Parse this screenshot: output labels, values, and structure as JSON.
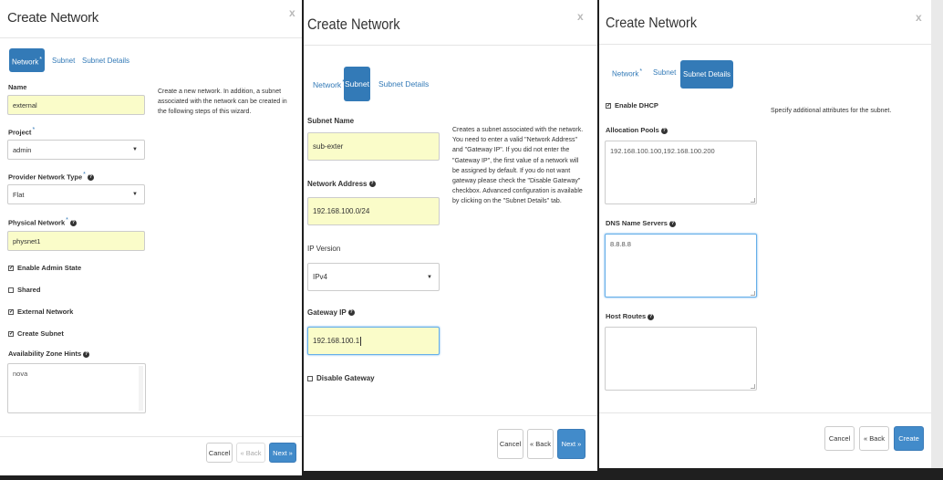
{
  "panel1": {
    "title": "Create Network",
    "close_glyph": "x",
    "tabs": [
      {
        "label": "Network",
        "required": "*",
        "active": true
      },
      {
        "label": "Subnet",
        "active": false
      },
      {
        "label": "Subnet Details",
        "active": false
      }
    ],
    "name": {
      "label": "Name",
      "value": "external"
    },
    "project": {
      "label": "Project",
      "required": "*",
      "value": "admin"
    },
    "provider_type": {
      "label": "Provider Network Type",
      "required": "*",
      "value": "Flat"
    },
    "physical_network": {
      "label": "Physical Network",
      "required": "*",
      "value": "physnet1"
    },
    "checkboxes": [
      {
        "label": "Enable Admin State",
        "checked": true
      },
      {
        "label": "Shared",
        "checked": false
      },
      {
        "label": "External Network",
        "checked": true
      },
      {
        "label": "Create Subnet",
        "checked": true
      }
    ],
    "az_hints": {
      "label": "Availability Zone Hints",
      "options": [
        "nova"
      ]
    },
    "description": "Create a new network. In addition, a subnet associated with the network can be created in the following steps of this wizard.",
    "buttons": {
      "cancel": "Cancel",
      "back": "« Back",
      "next": "Next »"
    }
  },
  "panel2": {
    "title": "Create Network",
    "close_glyph": "x",
    "tabs": [
      {
        "label": "Network",
        "required": "*",
        "active": false
      },
      {
        "label": "Subnet",
        "active": true
      },
      {
        "label": "Subnet Details",
        "active": false
      }
    ],
    "subnet_name": {
      "label": "Subnet Name",
      "value": "sub-exter"
    },
    "network_address": {
      "label": "Network Address",
      "value": "192.168.100.0/24"
    },
    "ip_version": {
      "label": "IP Version",
      "value": "IPv4"
    },
    "gateway_ip": {
      "label": "Gateway IP",
      "value": "192.168.100.1"
    },
    "disable_gateway": {
      "label": "Disable Gateway",
      "checked": false
    },
    "description": "Creates a subnet associated with the network. You need to enter a valid \"Network Address\" and \"Gateway IP\". If you did not enter the \"Gateway IP\", the first value of a network will be assigned by default. If you do not want gateway please check the \"Disable Gateway\" checkbox. Advanced configuration is available by clicking on the \"Subnet Details\" tab.",
    "buttons": {
      "cancel": "Cancel",
      "back": "« Back",
      "next": "Next »"
    }
  },
  "panel3": {
    "title": "Create Network",
    "close_glyph": "x",
    "tabs": [
      {
        "label": "Network",
        "required": "*",
        "active": false
      },
      {
        "label": "Subnet",
        "active": false
      },
      {
        "label": "Subnet Details",
        "active": true
      }
    ],
    "enable_dhcp": {
      "label": "Enable DHCP",
      "checked": true
    },
    "allocation_pools": {
      "label": "Allocation Pools",
      "value": "192.168.100.100,192.168.100.200"
    },
    "dns_servers": {
      "label": "DNS Name Servers",
      "value": "8.8.8.8"
    },
    "host_routes": {
      "label": "Host Routes",
      "value": ""
    },
    "description": "Specify additional attributes for the subnet.",
    "buttons": {
      "cancel": "Cancel",
      "back": "« Back",
      "create": "Create"
    }
  },
  "colors": {
    "primary": "#428bca",
    "tab_active": "#337ab7",
    "autofill": "#fafcc9",
    "focus": "#66afe9"
  }
}
